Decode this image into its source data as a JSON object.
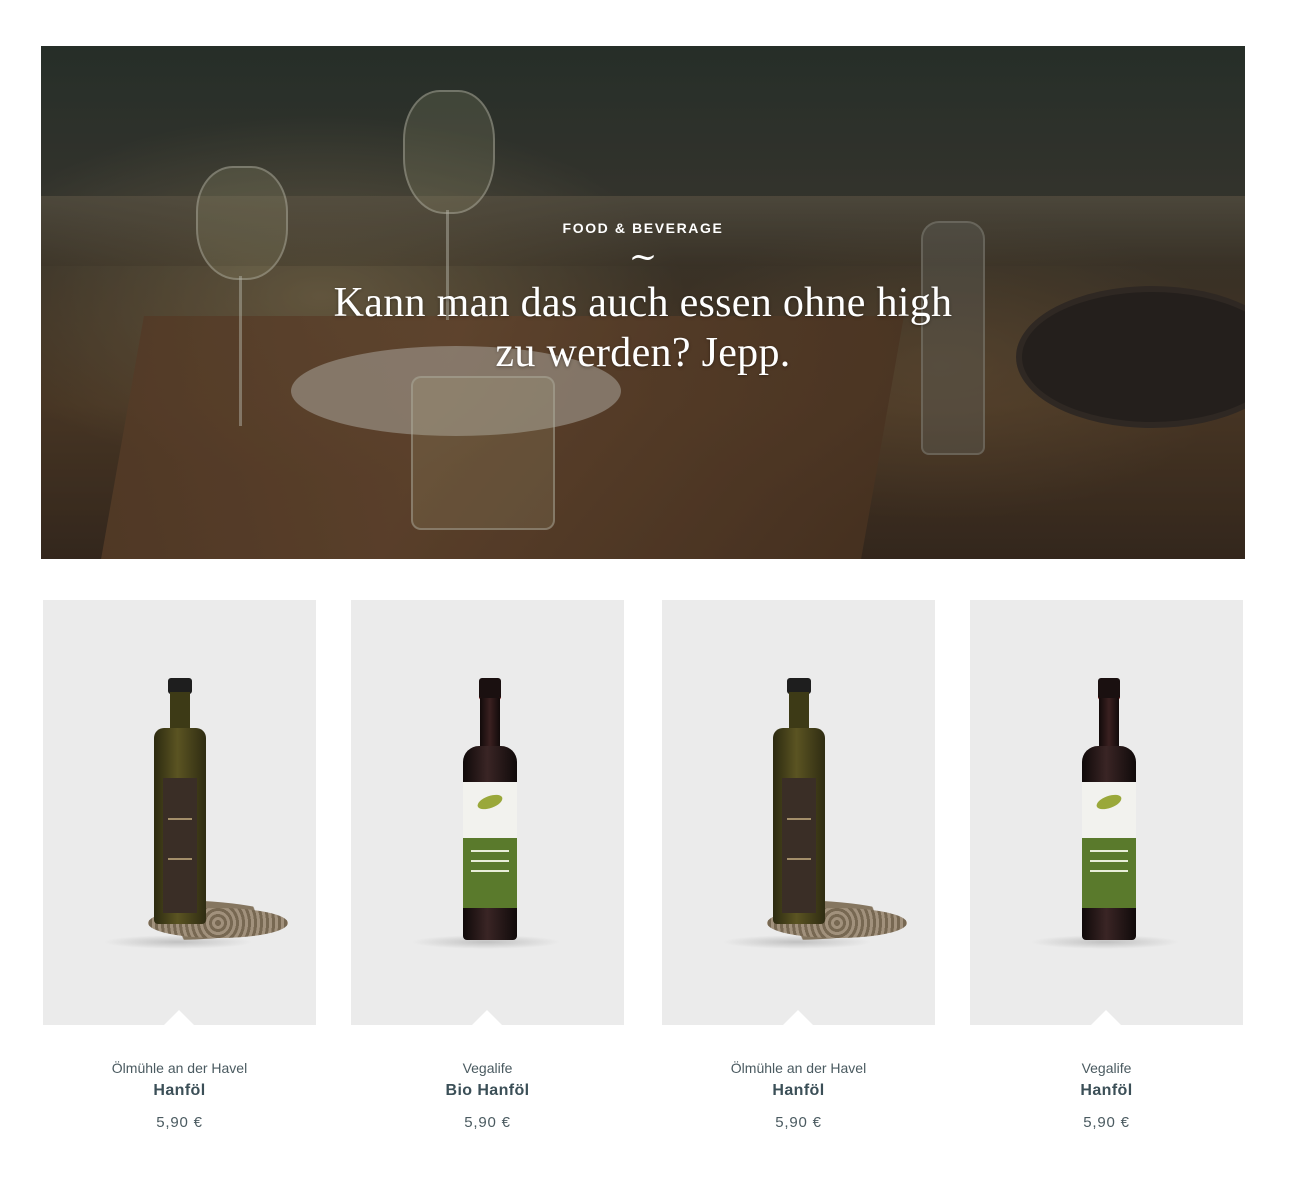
{
  "hero": {
    "eyebrow": "FOOD & BEVERAGE",
    "tilde": "~",
    "headline": "Kann man das auch essen ohne high zu werden? Jepp."
  },
  "products": [
    {
      "brand": "Ölmühle an der Havel",
      "name": "Hanföl",
      "price": "5,90 €",
      "bottle": "olive-bottle-with-seeds"
    },
    {
      "brand": "Vegalife",
      "name": "Bio Hanföl",
      "price": "5,90 €",
      "bottle": "dark-bottle-green-label"
    },
    {
      "brand": "Ölmühle an der Havel",
      "name": "Hanföl",
      "price": "5,90 €",
      "bottle": "olive-bottle-with-seeds"
    },
    {
      "brand": "Vegalife",
      "name": "Hanföl",
      "price": "5,90 €",
      "bottle": "dark-bottle-green-label"
    }
  ]
}
